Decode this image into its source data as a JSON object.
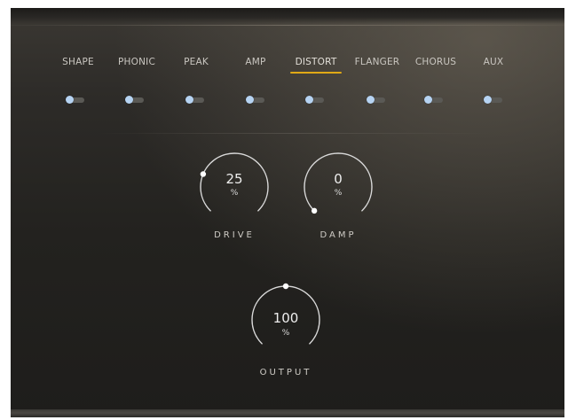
{
  "tabs": [
    {
      "label": "SHAPE",
      "enabled": false
    },
    {
      "label": "PHONIC",
      "enabled": false
    },
    {
      "label": "PEAK",
      "enabled": false
    },
    {
      "label": "AMP",
      "enabled": false
    },
    {
      "label": "DISTORT",
      "enabled": false,
      "active": true
    },
    {
      "label": "FLANGER",
      "enabled": false
    },
    {
      "label": "CHORUS",
      "enabled": false
    },
    {
      "label": "AUX",
      "enabled": false
    }
  ],
  "knobs": {
    "drive": {
      "value": "25",
      "unit": "%",
      "label": "DRIVE",
      "level": 0.25
    },
    "damp": {
      "value": "0",
      "unit": "%",
      "label": "DAMP",
      "level": 0.0
    },
    "output": {
      "value": "100",
      "unit": "%",
      "label": "OUTPUT",
      "level": 0.5
    }
  },
  "colors": {
    "accent": "#e0a916",
    "toggle_knob": "#b6d3f2",
    "toggle_track": "#5a5955",
    "knob_arc": "#d9d9d9"
  }
}
